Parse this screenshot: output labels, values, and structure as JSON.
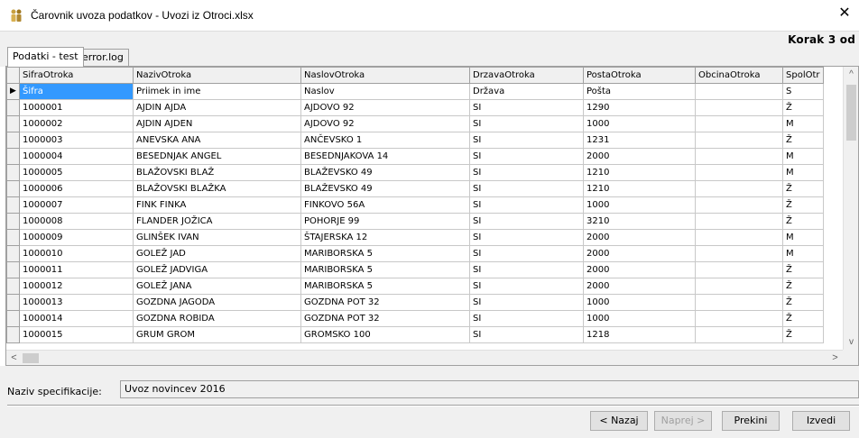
{
  "window": {
    "title": "Čarovnik uvoza podatkov - Uvozi iz Otroci.xlsx",
    "close_glyph": "✕",
    "step_text": "Korak 3 od"
  },
  "tabs": [
    {
      "label": "Podatki - test",
      "active": true
    },
    {
      "label": "error.log",
      "active": false
    }
  ],
  "grid": {
    "columns": [
      "SifraOtroka",
      "NazivOtroka",
      "NaslovOtroka",
      "DrzavaOtroka",
      "PostaOtroka",
      "ObcinaOtroka",
      "SpolOtr"
    ],
    "rows": [
      [
        "Šifra",
        "Priimek in ime",
        "Naslov",
        "Država",
        "Pošta",
        "",
        "S"
      ],
      [
        "1000001",
        "AJDIN AJDA",
        "AJDOVO 92",
        "SI",
        "1290",
        "",
        "Ž"
      ],
      [
        "1000002",
        "AJDIN AJDEN",
        "AJDOVO 92",
        "SI",
        "1000",
        "",
        "M"
      ],
      [
        "1000003",
        "ANEVSKA ANA",
        "ANČEVSKO 1",
        "SI",
        "1231",
        "",
        "Ž"
      ],
      [
        "1000004",
        "BESEDNJAK ANGEL",
        "BESEDNJAKOVA 14",
        "SI",
        "2000",
        "",
        "M"
      ],
      [
        "1000005",
        "BLAŽOVSKI BLAŽ",
        "BLAŽEVSKO 49",
        "SI",
        "1210",
        "",
        "M"
      ],
      [
        "1000006",
        "BLAŽOVSKI BLAŽKA",
        "BLAŽEVSKO 49",
        "SI",
        "1210",
        "",
        "Ž"
      ],
      [
        "1000007",
        "FINK FINKA",
        "FINKOVO 56A",
        "SI",
        "1000",
        "",
        "Ž"
      ],
      [
        "1000008",
        "FLANDER JOŽICA",
        "POHORJE 99",
        "SI",
        "3210",
        "",
        "Ž"
      ],
      [
        "1000009",
        "GLINŠEK IVAN",
        "ŠTAJERSKA 12",
        "SI",
        "2000",
        "",
        "M"
      ],
      [
        "1000010",
        "GOLEŽ JAD",
        "MARIBORSKA 5",
        "SI",
        "2000",
        "",
        "M"
      ],
      [
        "1000011",
        "GOLEŽ JADVIGA",
        "MARIBORSKA 5",
        "SI",
        "2000",
        "",
        "Ž"
      ],
      [
        "1000012",
        "GOLEŽ JANA",
        "MARIBORSKA 5",
        "SI",
        "2000",
        "",
        "Ž"
      ],
      [
        "1000013",
        "GOZDNA JAGODA",
        "GOZDNA POT 32",
        "SI",
        "1000",
        "",
        "Ž"
      ],
      [
        "1000014",
        "GOZDNA ROBIDA",
        "GOZDNA POT 32",
        "SI",
        "1000",
        "",
        "Ž"
      ],
      [
        "1000015",
        "GRUM GROM",
        "GROMSKO 100",
        "SI",
        "1218",
        "",
        "Ž"
      ]
    ],
    "current_row_marker": "▶",
    "scroll": {
      "up": "^",
      "down": "v",
      "left": "<",
      "right": ">"
    }
  },
  "footer": {
    "spec_label": "Naziv specifikacije:",
    "spec_value": "Uvoz novincev 2016",
    "buttons": {
      "back": "< Nazaj",
      "next": "Naprej >",
      "cancel": "Prekini",
      "run": "Izvedi"
    }
  },
  "colors": {
    "selection": "#3399ff",
    "chrome": "#f0f0f0",
    "disabled_text": "#a0a0a0"
  },
  "icons": {
    "app": "people-icon",
    "close": "close-icon"
  }
}
